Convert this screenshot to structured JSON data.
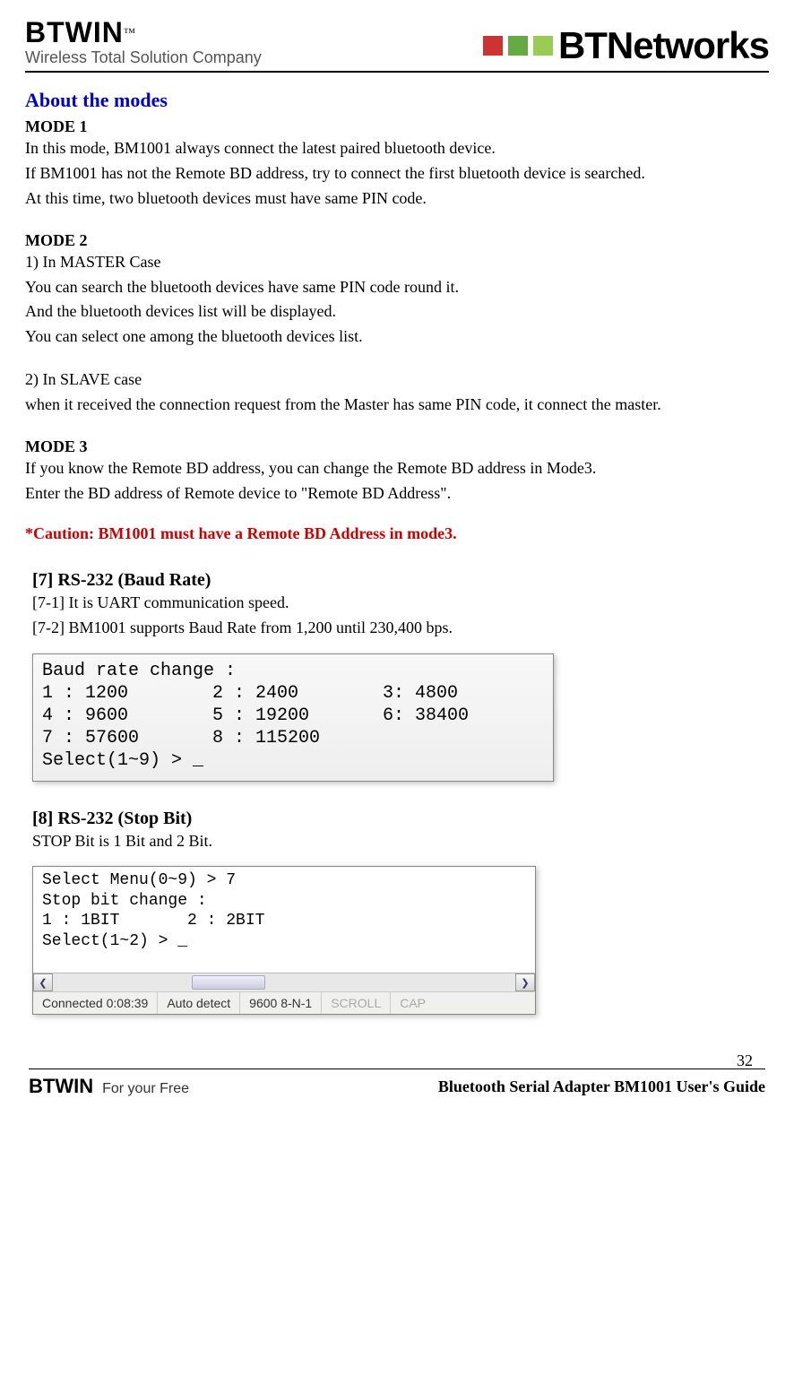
{
  "header": {
    "logo_main": "BTWIN",
    "logo_tm": "™",
    "logo_sub": "Wireless Total Solution Company",
    "right_logo": "BTNetworks"
  },
  "section_title": "About the modes",
  "mode1": {
    "h": "MODE 1",
    "l1": "In this mode, BM1001 always connect the latest paired bluetooth device.",
    "l2": "If BM1001 has not the Remote BD address, try to connect the first bluetooth device is searched.",
    "l3": "At this time, two bluetooth devices must have same PIN code."
  },
  "mode2": {
    "h": "MODE 2",
    "master_h": "1) In MASTER Case",
    "m1": "You can search the bluetooth devices have same PIN code round it.",
    "m2": "And the bluetooth devices list will be displayed.",
    "m3": "You can select one among the bluetooth devices list.",
    "slave_h": "2) In SLAVE case",
    "s1": "when it received the connection request from the Master has same PIN code, it connect the master."
  },
  "mode3": {
    "h": "MODE 3",
    "l1": "If you know the Remote BD address, you can change the Remote BD address in Mode3.",
    "l2": "Enter the BD address of Remote device to \"Remote BD Address\"."
  },
  "caution": "*Caution: BM1001 must have a Remote BD Address in mode3.",
  "sec7": {
    "h": "[7] RS-232 (Baud Rate)",
    "l1": "[7-1] It is UART communication speed.",
    "l2": "[7-2] BM1001 supports Baud Rate from 1,200 until 230,400 bps.",
    "term": {
      "title": "Baud rate change :",
      "r1c1": "1 : 1200",
      "r1c2": "2 : 2400",
      "r1c3": "3: 4800",
      "r2c1": "4 : 9600",
      "r2c2": "5 : 19200",
      "r2c3": "6: 38400",
      "r3c1": "7 : 57600",
      "r3c2": "8 : 115200",
      "prompt": "Select(1~9) > _"
    }
  },
  "sec8": {
    "h": "[8] RS-232 (Stop Bit)",
    "l1": "STOP Bit is 1 Bit and 2 Bit.",
    "term": {
      "l1": "Select Menu(0~9) > 7",
      "l2": "Stop bit change :",
      "l3a": "1 : 1BIT",
      "l3b": "2 : 2BIT",
      "l4": "Select(1~2) > _"
    },
    "status": {
      "conn": "Connected 0:08:39",
      "detect": "Auto detect",
      "port": "9600 8-N-1",
      "scroll": "SCROLL",
      "caps": "CAP"
    }
  },
  "footer": {
    "logo": "BTWIN",
    "tag": "For your Free",
    "guide": "Bluetooth Serial Adapter BM1001 User's Guide",
    "page": "32"
  }
}
